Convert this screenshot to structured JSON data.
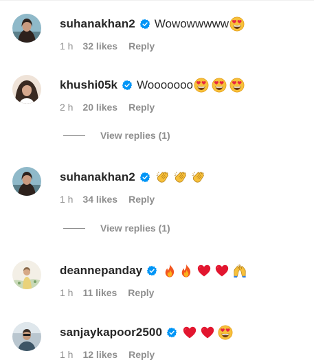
{
  "comments": [
    {
      "username": "suhanakhan2",
      "text": "Wowowwwww",
      "emojis": [
        "heart-eyes-emoji"
      ],
      "time": "1 h",
      "likes": "32 likes",
      "reply": "Reply",
      "verified": true
    },
    {
      "username": "khushi05k",
      "text": "Wooooooo",
      "emojis": [
        "heart-eyes-emoji",
        "heart-eyes-emoji",
        "heart-eyes-emoji"
      ],
      "time": "2 h",
      "likes": "20 likes",
      "reply": "Reply",
      "verified": true,
      "view_replies": "View replies (1)"
    },
    {
      "username": "suhanakhan2",
      "text": "",
      "emojis": [
        "clapping-hands-emoji",
        "clapping-hands-emoji",
        "clapping-hands-emoji"
      ],
      "time": "1 h",
      "likes": "34 likes",
      "reply": "Reply",
      "verified": true,
      "view_replies": "View replies (1)"
    },
    {
      "username": "deannepanday",
      "text": "",
      "emojis": [
        "fire-emoji",
        "fire-emoji",
        "red-heart-emoji",
        "red-heart-emoji",
        "raising-hands-emoji"
      ],
      "time": "1 h",
      "likes": "11 likes",
      "reply": "Reply",
      "verified": true
    },
    {
      "username": "sanjaykapoor2500",
      "text": "",
      "emojis": [
        "red-heart-emoji",
        "red-heart-emoji",
        "heart-eyes-emoji"
      ],
      "time": "1 h",
      "likes": "12 likes",
      "reply": "Reply",
      "verified": true
    }
  ],
  "colors": {
    "verified_blue": "#0095f6",
    "text_primary": "#262626",
    "text_secondary": "#8e8e8e"
  }
}
